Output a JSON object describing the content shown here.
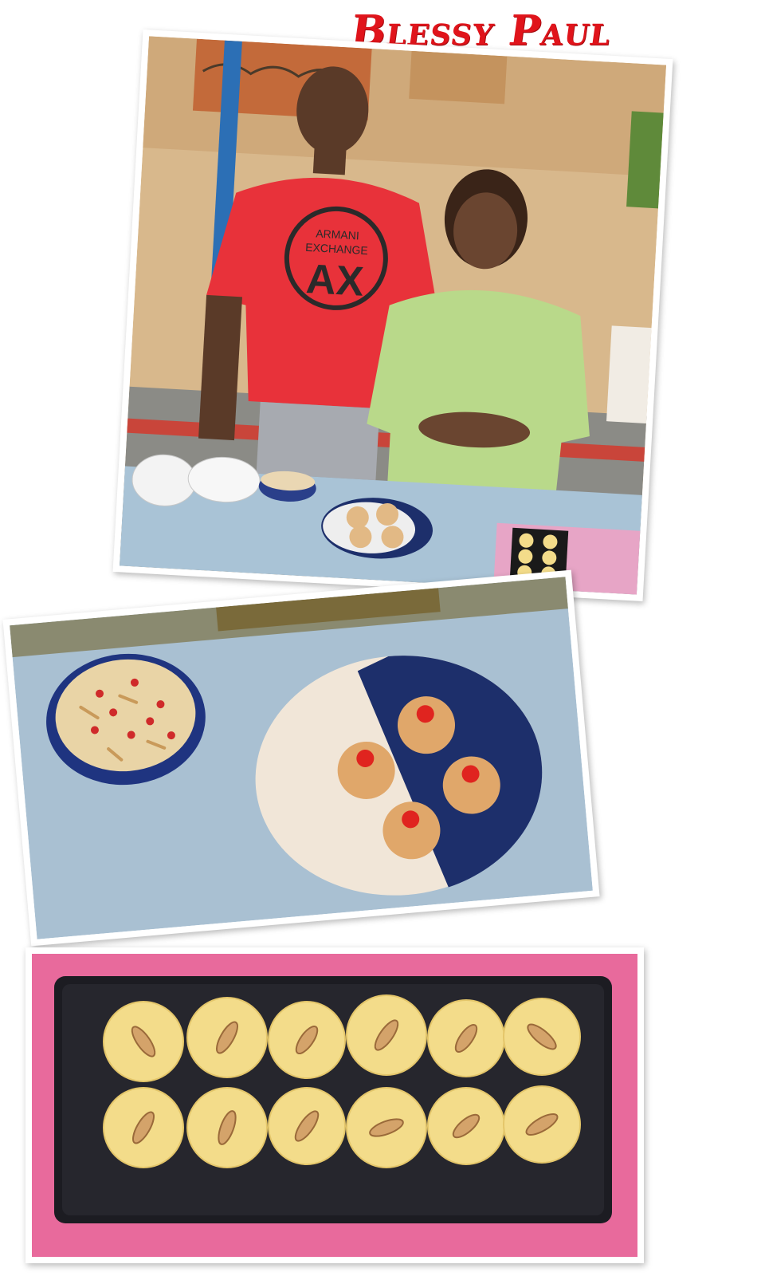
{
  "caption": {
    "name": "Blessy Paul"
  },
  "photos": [
    {
      "icon": "people-with-desserts-photo"
    },
    {
      "icon": "payasam-and-coconut-laddoo-photo"
    },
    {
      "icon": "almond-milk-cakes-tray-photo"
    }
  ],
  "shirt_print": {
    "brand_top": "ARMANI",
    "brand_mid": "EXCHANGE",
    "logo": "AX"
  },
  "colors": {
    "title": "#e0141b",
    "shirt": "#e8323a",
    "kurta": "#b9d98a",
    "table_cloth": "#a9c3d6",
    "plate_blue": "#1d2f6b",
    "pink_cloth": "#e86a9c",
    "cake": "#f3dc8a"
  }
}
